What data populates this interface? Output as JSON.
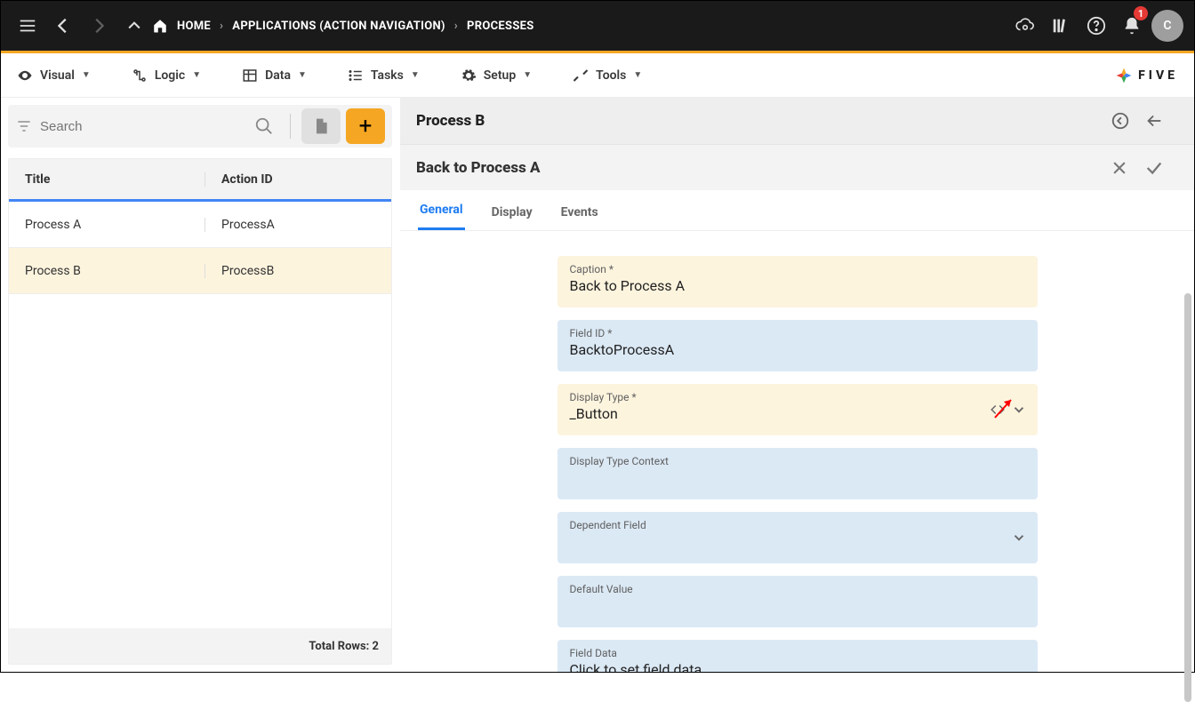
{
  "topbar": {
    "home": "HOME",
    "crumb1": "APPLICATIONS (ACTION NAVIGATION)",
    "crumb2": "PROCESSES",
    "notif_count": "1",
    "avatar_letter": "C"
  },
  "menu": {
    "visual": "Visual",
    "logic": "Logic",
    "data": "Data",
    "tasks": "Tasks",
    "setup": "Setup",
    "tools": "Tools",
    "brand": "FIVE"
  },
  "search": {
    "placeholder": "Search"
  },
  "table": {
    "col_title": "Title",
    "col_action": "Action ID",
    "rows": [
      {
        "title": "Process A",
        "action": "ProcessA"
      },
      {
        "title": "Process B",
        "action": "ProcessB"
      }
    ],
    "footer": "Total Rows: 2"
  },
  "panel": {
    "title1": "Process B",
    "title2": "Back to Process A"
  },
  "tabs": {
    "general": "General",
    "display": "Display",
    "events": "Events"
  },
  "form": {
    "caption_lbl": "Caption *",
    "caption_val": "Back to Process A",
    "fieldid_lbl": "Field ID *",
    "fieldid_val": "BacktoProcessA",
    "disptype_lbl": "Display Type *",
    "disptype_val": "_Button",
    "dispctx_lbl": "Display Type Context",
    "dispctx_val": "",
    "depfield_lbl": "Dependent Field",
    "depfield_val": "",
    "defval_lbl": "Default Value",
    "defval_val": "",
    "fielddata_lbl": "Field Data",
    "fielddata_val": "Click to set field data"
  }
}
